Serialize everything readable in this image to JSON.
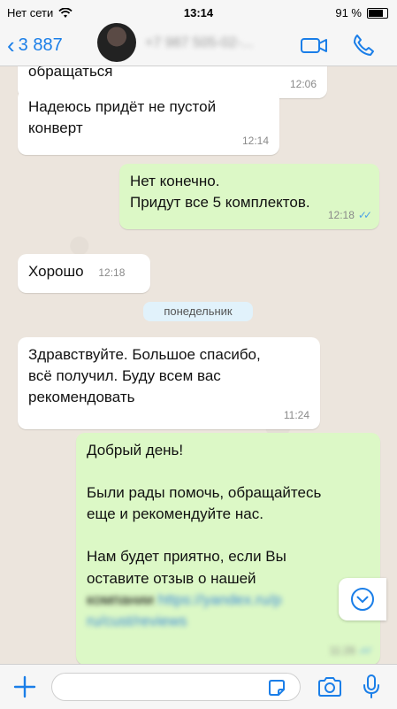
{
  "status": {
    "carrier": "Нет сети",
    "time": "13:14",
    "battery": "91 %",
    "battery_level": 0.91
  },
  "header": {
    "back_count": "3 887",
    "contact_name": "+7 987 505-02-..."
  },
  "messages": {
    "m0": {
      "text": "обращаться",
      "time": "12:06"
    },
    "m1": {
      "text_l1": "Надеюсь придёт не пустой",
      "text_l2": "конверт",
      "time": "12:14"
    },
    "m2": {
      "text_l1": "Нет конечно.",
      "text_l2": "Придут все 5 комплектов.",
      "time": "12:18"
    },
    "m3": {
      "text": "Хорошо",
      "time": "12:18"
    },
    "date": "понедельник",
    "m4": {
      "text_l1": "Здравствуйте. Большое спасибо,",
      "text_l2": "всё получил. Буду всем вас",
      "text_l3": "рекомендовать",
      "time": "11:24"
    },
    "m5": {
      "l1": "Добрый день!",
      "l2": "Были рады помочь, обращайтесь",
      "l3": "еще и рекомендуйте нас.",
      "l4": "Нам будет приятно, если Вы",
      "l5": "оставите отзыв о нашей",
      "l6a": "компании",
      "l6b": "https://yandex.ru/p",
      "l7": "ru/cust/reviews",
      "time": "11:26"
    }
  },
  "colors": {
    "accent": "#1a7ee8",
    "outgoing": "#dcf8c6",
    "incoming": "#ffffff",
    "ticks": "#4fa3e8"
  },
  "icons": [
    "wifi-icon",
    "battery-icon",
    "chevron-left-icon",
    "video-call-icon",
    "phone-icon",
    "chevron-down-icon",
    "plus-icon",
    "sticker-icon",
    "camera-icon",
    "microphone-icon"
  ]
}
